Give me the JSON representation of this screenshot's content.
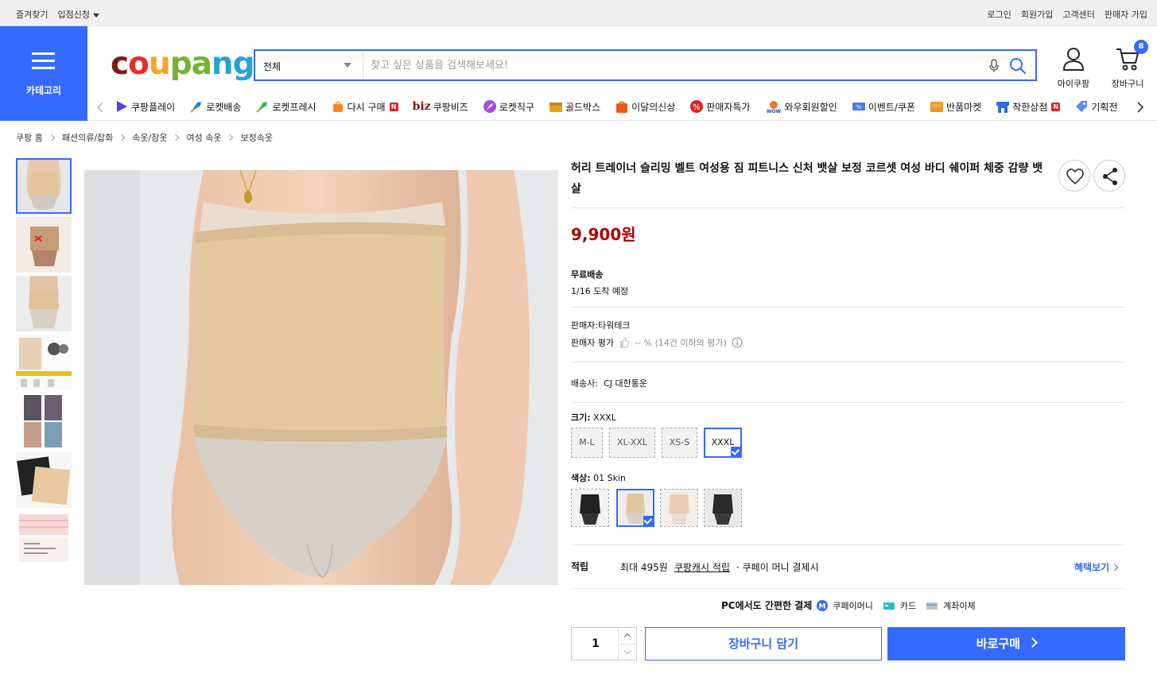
{
  "topbar": {
    "left": [
      "즐겨찾기",
      "입점신청"
    ],
    "right": [
      "로그인",
      "회원가입",
      "고객센터",
      "판매자 가입"
    ]
  },
  "category_label": "카테고리",
  "logo": {
    "p1": "c",
    "p2": "o",
    "p3": "u",
    "p4": "pa",
    "p5": "ng"
  },
  "search": {
    "category": "전체",
    "placeholder": "찾고 싶은 상품을 검색해보세요!"
  },
  "header_actions": {
    "mycoupang": "마이쿠팡",
    "cart": "장바구니",
    "cart_count": "8"
  },
  "nav": [
    {
      "label": "쿠팡플레이",
      "color": "#5b3cf5"
    },
    {
      "label": "로켓배송",
      "color": "#2c7be5"
    },
    {
      "label": "로켓프레시",
      "color": "#3bb34a"
    },
    {
      "label": "다시 구매",
      "color": "#f28b1e"
    },
    {
      "label": "쿠팡비즈",
      "color": "#7a1c12"
    },
    {
      "label": "로켓직구",
      "color": "#a54ddb"
    },
    {
      "label": "골드박스",
      "color": "#e6a21a"
    },
    {
      "label": "이달의신상",
      "color": "#e85a1b"
    },
    {
      "label": "판매자특가",
      "color": "#d7261e"
    },
    {
      "label": "와우회원할인",
      "color": "#f0781e"
    },
    {
      "label": "이벤트/쿠폰",
      "color": "#4f7de8"
    },
    {
      "label": "반품마켓",
      "color": "#e89a26"
    },
    {
      "label": "착한상점",
      "color": "#2f6ee0"
    },
    {
      "label": "기획전",
      "color": "#5c8cf0"
    }
  ],
  "nav_badges": {
    "rebuy": "N",
    "biz": "biz",
    "goodshop": "N"
  },
  "breadcrumb": [
    "쿠팡 홈",
    "패션의류/잡화",
    "속옷/잠옷",
    "여성 속옷",
    "보정속옷"
  ],
  "product": {
    "title": "허리 트레이너 슬리밍 벨트 여성용 짐 피트니스 신처 뱃살 보정 코르셋 여성 바디 쉐이퍼 체중 감량 뱃살",
    "price": "9,900원",
    "shipping_label": "무료배송",
    "arrival": "1/16 도착 예정",
    "seller": "판매자:타워테크",
    "seller_rating_label": "판매자 평가",
    "seller_rating_value": "-- % (14건 이하의 평가)",
    "carrier_label": "배송사:",
    "carrier": "CJ 대한통운",
    "size_label": "크기:",
    "size_selected": "XXXL",
    "sizes": [
      "M-L",
      "XL-XXL",
      "XS-S",
      "XXXL"
    ],
    "color_label": "색상:",
    "color_selected": "01 Skin",
    "reward_label": "적립",
    "reward_text": "최대 495원",
    "reward_link": "쿠팡캐시 적립",
    "reward_suffix": "· 쿠페이 머니 결제시",
    "benefit_link": "혜택보기",
    "pay_title": "PC에서도 간편한 결제",
    "pay_methods": [
      "쿠페이머니",
      "카드",
      "계좌이체"
    ],
    "quantity": "1",
    "cart_button": "장바구니 담기",
    "buy_button": "바로구매"
  },
  "colors": {
    "accent": "#346aff",
    "price": "#ae0000"
  }
}
